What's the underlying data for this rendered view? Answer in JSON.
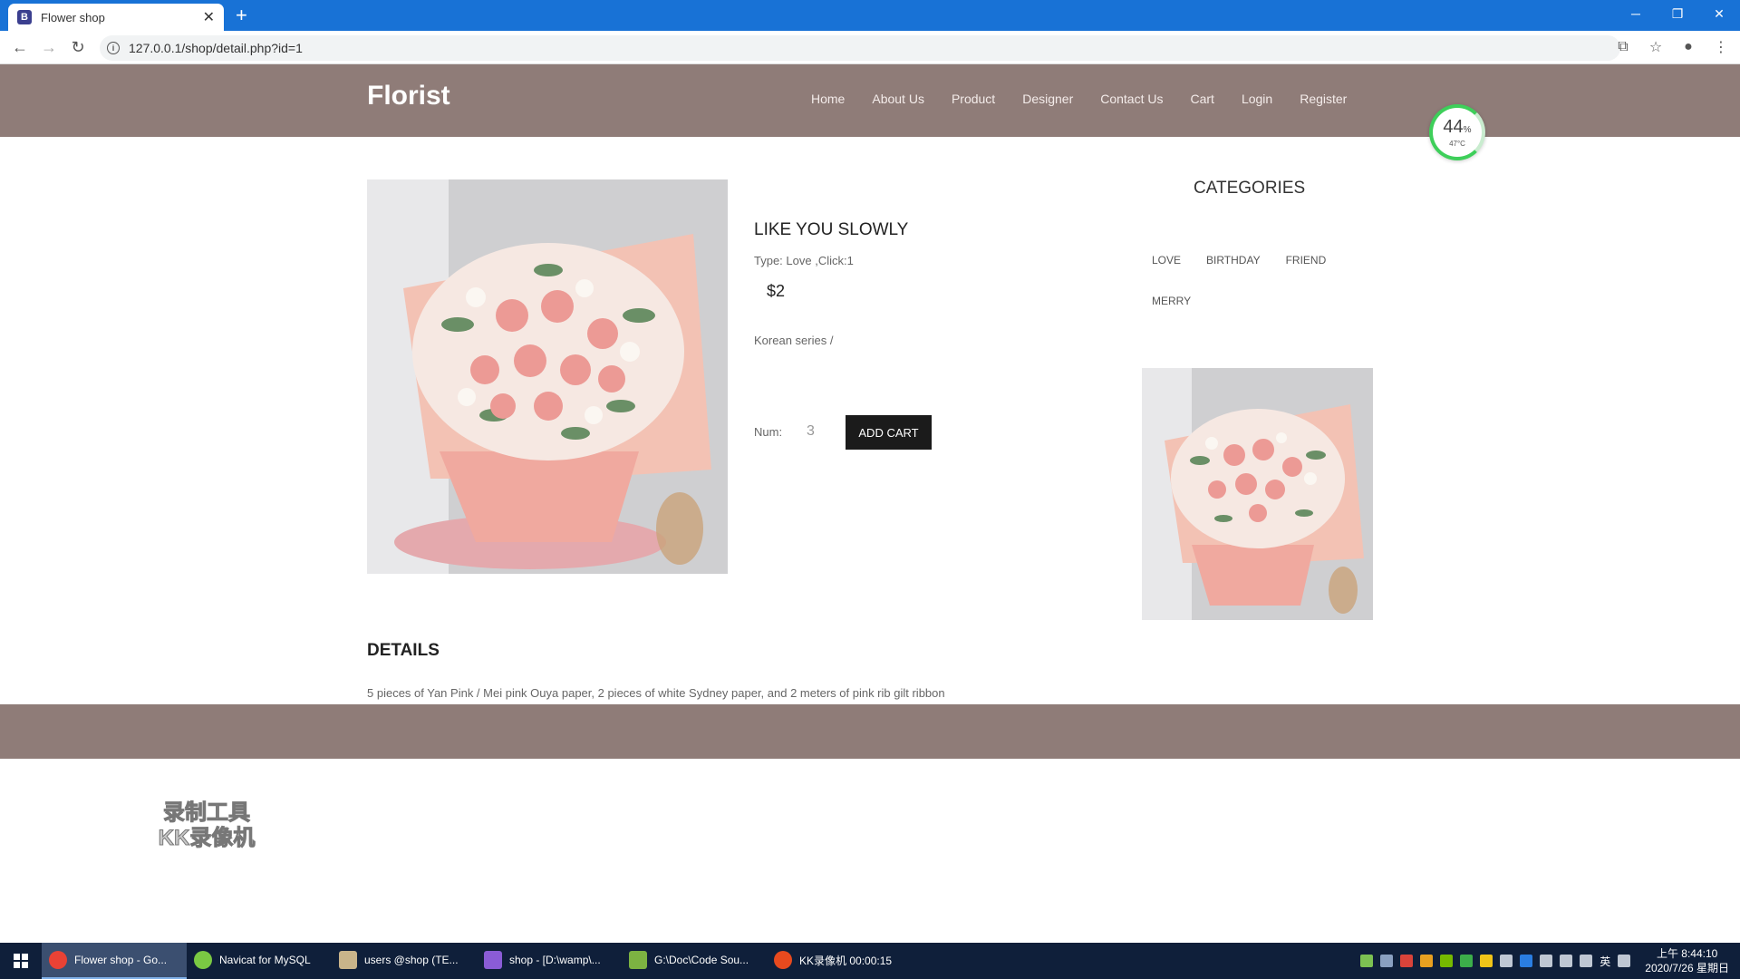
{
  "browser": {
    "tab_title": "Flower shop",
    "tab_favicon": "B",
    "url": "127.0.0.1/shop/detail.php?id=1"
  },
  "site": {
    "logo": "Florist",
    "nav": [
      "Home",
      "About Us",
      "Product",
      "Designer",
      "Contact Us",
      "Cart",
      "Login",
      "Register"
    ]
  },
  "gauge": {
    "percent": "44",
    "unit": "%",
    "temp": "47°C"
  },
  "product": {
    "title": "LIKE YOU SLOWLY",
    "meta": "Type: Love ,Click:1",
    "price": "$2",
    "series": "Korean series /",
    "num_label": "Num:",
    "num_value": "3",
    "add_cart_label": "ADD CART"
  },
  "categories": {
    "title": "CATEGORIES",
    "items": [
      "LOVE",
      "BIRTHDAY",
      "FRIEND",
      "MERRY"
    ]
  },
  "details": {
    "title": "DETAILS",
    "text": "5 pieces of Yan Pink / Mei pink Ouya paper, 2 pieces of white Sydney paper, and 2 meters of pink rib gilt ribbon"
  },
  "watermark": {
    "line1": "录制工具",
    "line2": "KK录像机"
  },
  "taskbar": {
    "items": [
      {
        "label": "Flower shop - Go...",
        "color": "#e94235"
      },
      {
        "label": "Navicat for MySQL",
        "color": "#7ac943"
      },
      {
        "label": "users @shop (TE...",
        "color": "#c9b48a"
      },
      {
        "label": "shop - [D:\\wamp\\...",
        "color": "#8a5cd6"
      },
      {
        "label": "G:\\Doc\\Code Sou...",
        "color": "#7cb342"
      },
      {
        "label": "KK录像机 00:00:15",
        "color": "#e84a1e"
      }
    ],
    "ime": "英",
    "time": "上午 8:44:10",
    "date": "2020/7/26 星期日"
  },
  "colors": {
    "header_bg": "#8f7c78",
    "chrome_blue": "#1872d6",
    "button_dark": "#1b1b1b"
  }
}
